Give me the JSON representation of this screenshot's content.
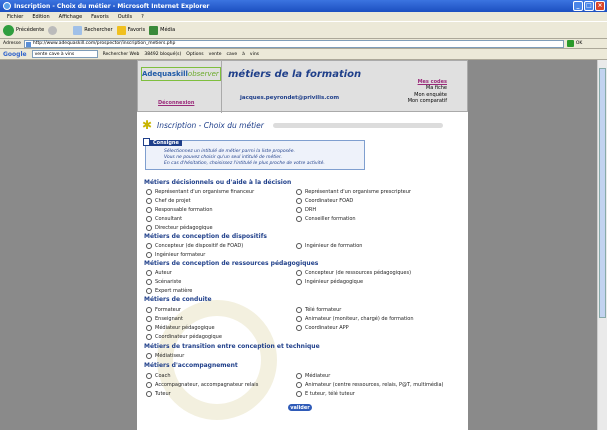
{
  "window": {
    "title": "Inscription - Choix du métier - Microsoft Internet Explorer",
    "buttons": [
      "_",
      "□",
      "×"
    ]
  },
  "menu": [
    "Fichier",
    "Edition",
    "Affichage",
    "Favoris",
    "Outils",
    "?"
  ],
  "toolbar": {
    "back": "Précédente",
    "search": "Rechercher",
    "favorites": "Favoris",
    "media": "Média"
  },
  "address": {
    "label": "Adresse",
    "url": "http://www.adequaskill.com/prospector/inscription_metiers.php",
    "go": "OK"
  },
  "googlebar": {
    "logo": "Google",
    "search_value": "vente cave à vins",
    "web": "Rechercher Web",
    "blocked": "38492 bloqué(s)",
    "options": "Options",
    "links": [
      "vente",
      "cave",
      "à",
      "vins"
    ]
  },
  "header": {
    "logo_a": "Adequaskill",
    "logo_b": "observer",
    "deconnexion": "Déconnexion",
    "title": "métiers de la formation",
    "email": "jacques.peyrondet@privilis.com",
    "links": [
      "Mes codes",
      "Ma fiche",
      "Mon enquête",
      "Mon comparatif"
    ]
  },
  "page_title": "Inscription - Choix du métier",
  "consigne": {
    "label": "Consigne",
    "lines": [
      "Sélectionnez un intitulé de métier parmi la liste proposée.",
      "Vous ne pouvez choisir qu'un seul intitulé de métier.",
      "En cas d'hésitation, choisissez l'intitulé le plus proche de votre activité."
    ]
  },
  "sections": [
    {
      "title": "Métiers décisionnels ou d'aide à la décision",
      "options": [
        "Représentant d'un organisme financeur",
        "Représentant d'un organisme prescripteur",
        "Chef de projet",
        "Coordinateur FOAD",
        "Responsable formation",
        "DRH",
        "Consultant",
        "Conseiller formation",
        "Directeur pédagogique"
      ]
    },
    {
      "title": "Métiers de conception de dispositifs",
      "options": [
        "Concepteur (de dispositif de FOAD)",
        "Ingénieur de formation",
        "Ingénieur formateur"
      ]
    },
    {
      "title": "Métiers de conception de ressources pédagogiques",
      "options": [
        "Auteur",
        "Concepteur (de ressources pédagogiques)",
        "Scénariste",
        "Ingénieur pédagogique",
        "Expert matière"
      ]
    },
    {
      "title": "Métiers de conduite",
      "options": [
        "Formateur",
        "Télé formateur",
        "Enseignant",
        "Animateur (moniteur, chargé) de formation",
        "Médiateur pédagogique",
        "Coordinateur APP",
        "Coordinateur pédagogique"
      ]
    },
    {
      "title": "Métiers de transition entre conception et technique",
      "options": [
        "Médiatiseur"
      ]
    },
    {
      "title": "Métiers d'accompagnement",
      "options": [
        "Coach",
        "Médiateur",
        "Accompagnateur, accompagnateur relais",
        "Animateur (centre ressources, relais, P@T, multimédia)",
        "Tuteur",
        "E tuteur, télé tuteur"
      ]
    }
  ],
  "submit": "valider",
  "colors": {
    "xp_blue": "#1c4fc0",
    "heading_blue": "#1f3f8a",
    "accent_purple": "#9a2a7a",
    "logo_green": "#6aaa2a"
  }
}
